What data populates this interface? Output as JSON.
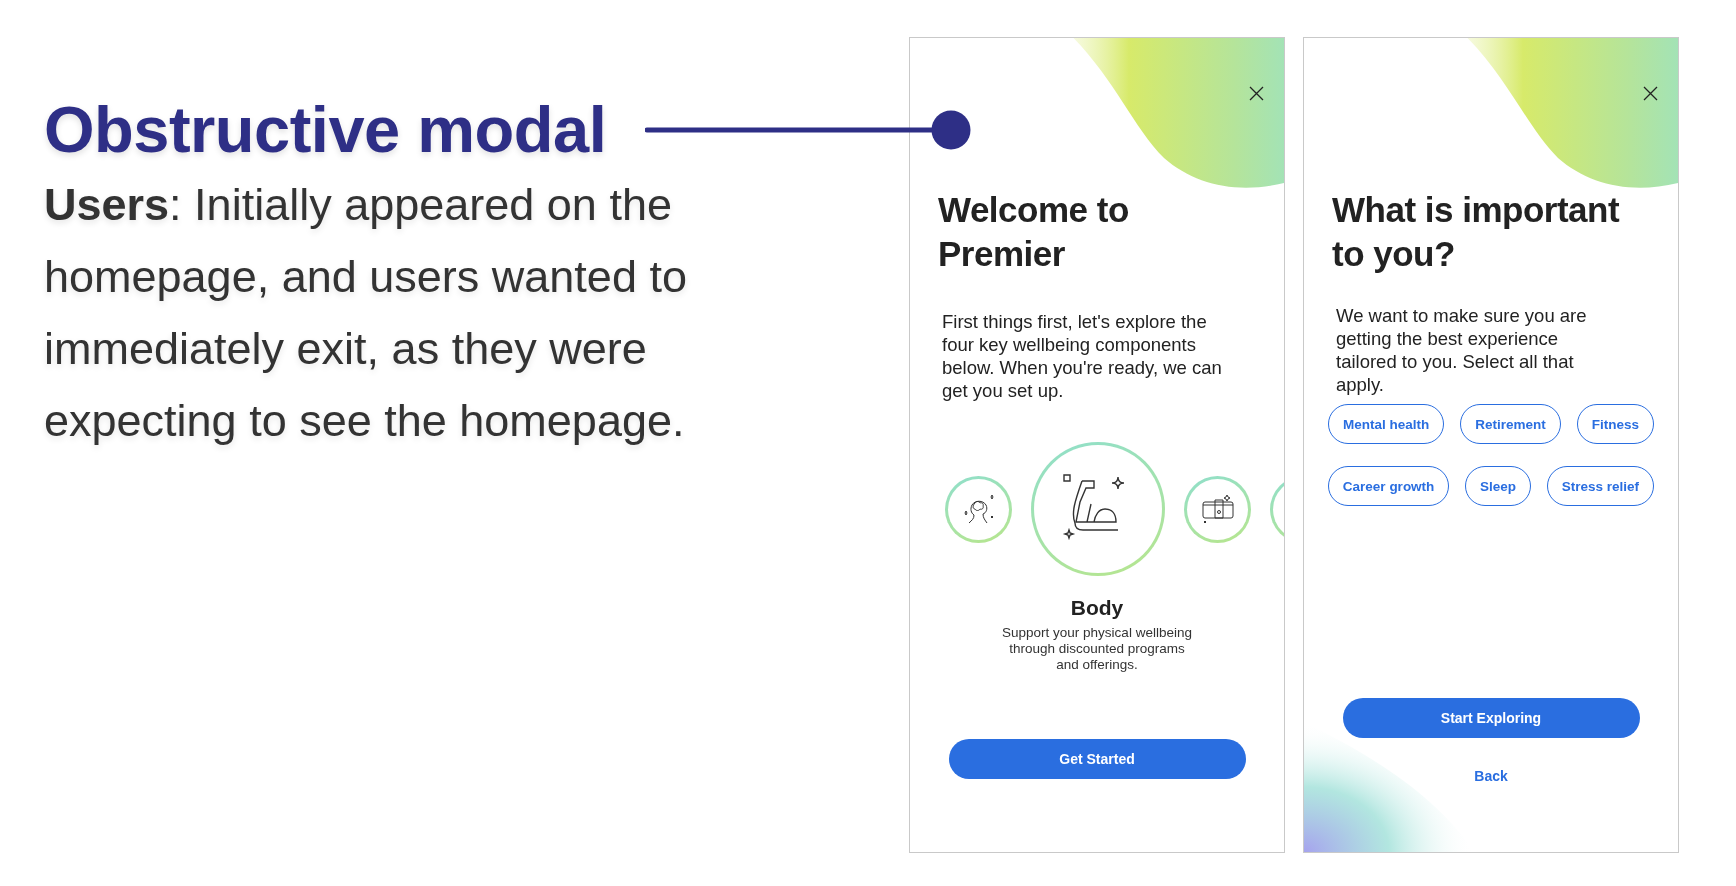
{
  "heading": "Obstructive modal",
  "description": "**Users**: Initially appeared on the homepage, and users wanted to immediately exit, as they were expecting to see the homepage.",
  "screens": [
    {
      "kind": "welcome",
      "title": "Welcome to Premier",
      "body": "First things first, let's explore the four key wellbeing components below. When you're ready, we can get you set up.",
      "carousel": [
        {
          "selected": false
        },
        {
          "selected": true
        },
        {
          "selected": false
        },
        {
          "selected": false
        }
      ],
      "feature": {
        "title": "Body",
        "text": "Support your physical wellbeing through discounted programs and offerings."
      },
      "primary_button": "Get Started"
    },
    {
      "kind": "interests",
      "title": "What is important to you?",
      "body": "We want to make sure you are getting the best experience tailored to you. Select all that apply.",
      "chips": [
        {
          "label": "Mental health",
          "selected": false
        },
        {
          "label": "Retirement",
          "selected": false
        },
        {
          "label": "Fitness",
          "selected": false
        },
        {
          "label": "Career growth",
          "selected": false
        },
        {
          "label": "Sleep",
          "selected": false
        },
        {
          "label": "Stress relief",
          "selected": false
        }
      ],
      "primary_button": "Start Exploring",
      "secondary_link": "Back"
    }
  ]
}
